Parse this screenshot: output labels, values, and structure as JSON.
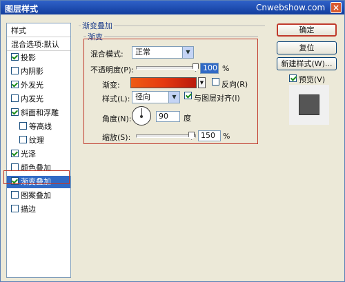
{
  "window": {
    "title": "图层样式",
    "watermark": "Cnwebshow.com",
    "close_glyph": "×"
  },
  "left_panel": {
    "header": "样式",
    "blend_options": "混合选项:默认",
    "items": [
      {
        "label": "投影",
        "checked": true,
        "sub": false
      },
      {
        "label": "内阴影",
        "checked": false,
        "sub": false
      },
      {
        "label": "外发光",
        "checked": true,
        "sub": false
      },
      {
        "label": "内发光",
        "checked": false,
        "sub": false
      },
      {
        "label": "斜面和浮雕",
        "checked": true,
        "sub": false
      },
      {
        "label": "等高线",
        "checked": false,
        "sub": true
      },
      {
        "label": "纹理",
        "checked": false,
        "sub": true
      },
      {
        "label": "光泽",
        "checked": true,
        "sub": false
      },
      {
        "label": "颜色叠加",
        "checked": false,
        "sub": false
      },
      {
        "label": "渐变叠加",
        "checked": true,
        "sub": false,
        "selected": true
      },
      {
        "label": "图案叠加",
        "checked": false,
        "sub": false
      },
      {
        "label": "描边",
        "checked": false,
        "sub": false
      }
    ]
  },
  "gradient_overlay": {
    "section_title": "渐变叠加",
    "group_title": "渐变",
    "blend_mode_label": "混合模式:",
    "blend_mode_value": "正常",
    "opacity_label": "不透明度(P):",
    "opacity_value": "100",
    "opacity_fraction": 1.0,
    "percent": "%",
    "gradient_label": "渐变:",
    "reverse_label": "反向(R)",
    "reverse_checked": false,
    "style_label": "样式(L):",
    "style_value": "径向",
    "align_label": "与图层对齐(I)",
    "align_checked": true,
    "angle_label": "角度(N):",
    "angle_value": "90",
    "angle_unit": "度",
    "scale_label": "缩放(S):",
    "scale_value": "150",
    "scale_fraction": 0.66
  },
  "buttons": {
    "ok": "确定",
    "reset": "复位",
    "new_style": "新建样式(W)...",
    "preview_label": "预览(V)",
    "preview_checked": true
  },
  "colors": {
    "accent": "#316ac5",
    "highlight_border": "#c0392b",
    "gradient_start": "#ee5b13",
    "gradient_end": "#b91a0d"
  }
}
